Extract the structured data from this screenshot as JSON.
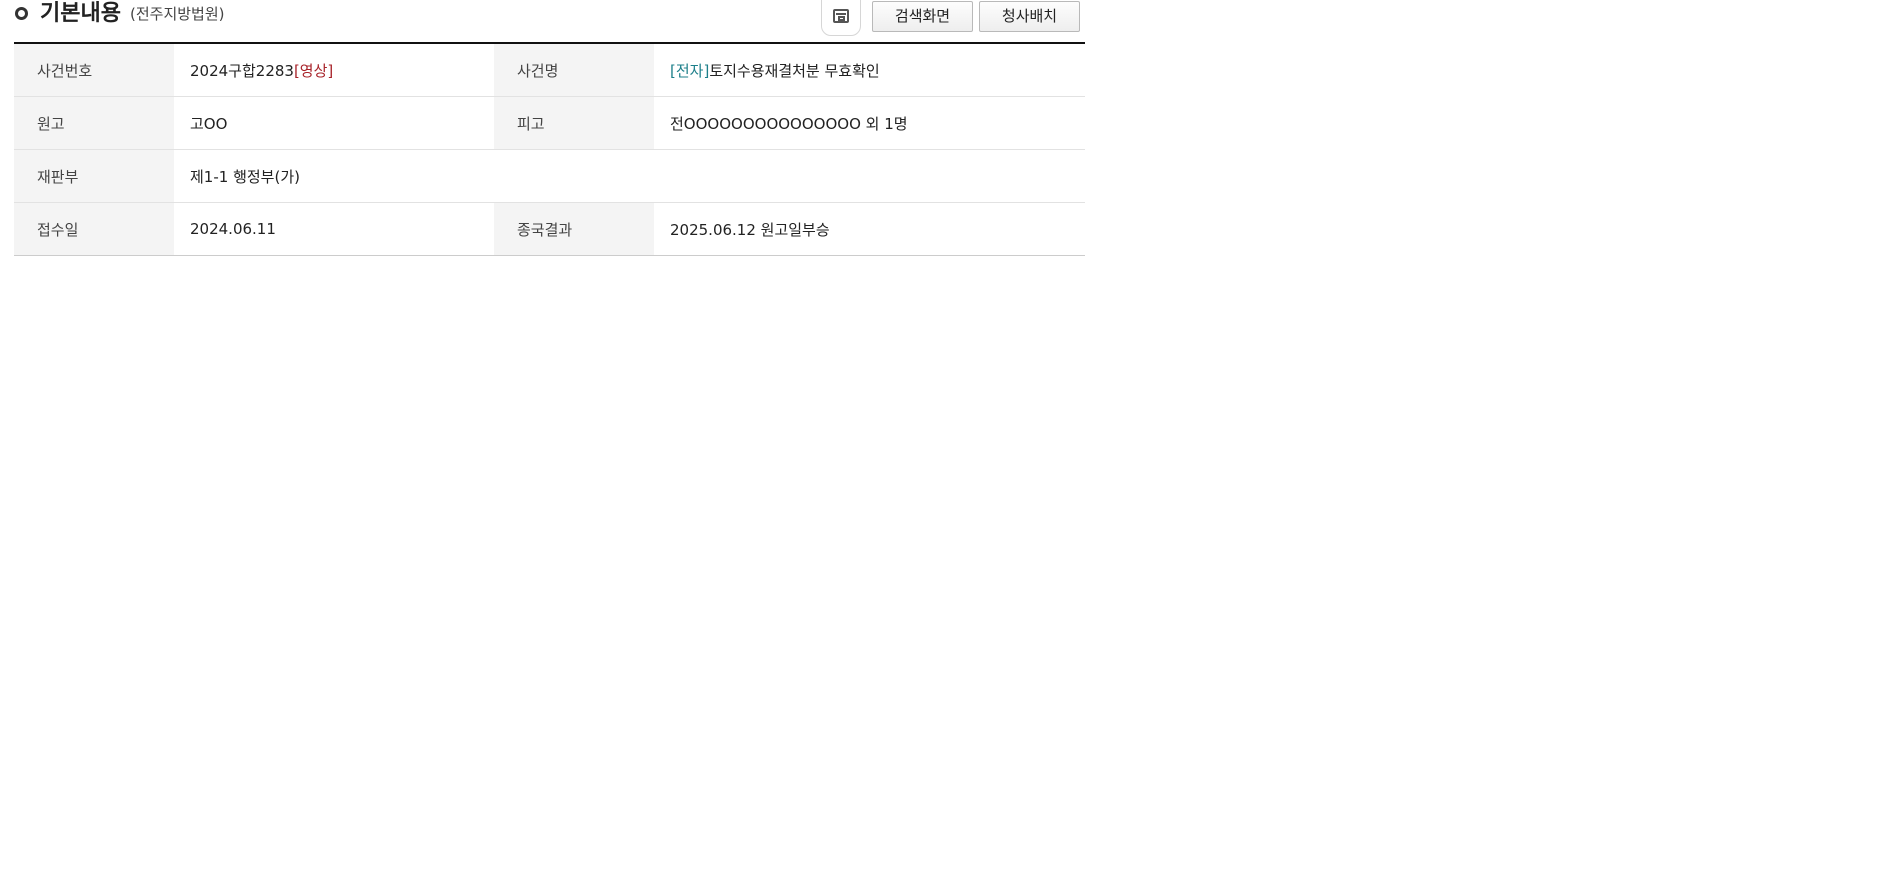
{
  "header": {
    "title": "기본내용",
    "subtitle": "(전주지방법원)",
    "buttons": {
      "popup_icon": "window-icon",
      "search_label": "검색화면",
      "court_label": "청사배치"
    }
  },
  "rows": [
    {
      "label1": "사건번호",
      "value1": "2024구합2283",
      "value1_tag": "[영상]",
      "label2": "사건명",
      "value2_tag": "[전자]",
      "value2": "토지수용재결처분 무효확인"
    },
    {
      "label1": "원고",
      "value1": "고OO",
      "label2": "피고",
      "value2": "전OOOOOOOOOOOOOOO 외 1명"
    },
    {
      "label1": "재판부",
      "value1": "제1-1 행정부(가)"
    },
    {
      "label1": "접수일",
      "value1": "2024.06.11",
      "label2": "종국결과",
      "value2": "2025.06.12 원고일부승"
    }
  ],
  "colors": {
    "tag_red": "#a8232a",
    "tag_teal": "#1d7f8a",
    "header_bg": "#f4f4f4",
    "rule": "#111111"
  }
}
